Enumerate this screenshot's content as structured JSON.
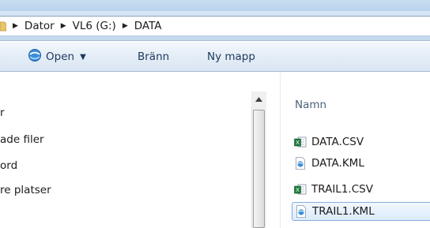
{
  "address": {
    "crumbs": [
      "Dator",
      "VL6 (G:)",
      "DATA"
    ]
  },
  "toolbar": {
    "open_label": "Open",
    "burn_label": "Bränn",
    "new_folder_label": "Ny mapp"
  },
  "nav": {
    "items": [
      "r",
      "ade filer",
      "ord",
      "re platser"
    ]
  },
  "content": {
    "column_header": "Namn",
    "files": [
      {
        "name": "DATA.CSV",
        "icon": "excel-csv-icon"
      },
      {
        "name": "DATA.KML",
        "icon": "kml-file-icon"
      },
      {
        "name": "TRAIL1.CSV",
        "icon": "excel-csv-icon"
      },
      {
        "name": "TRAIL1.KML",
        "icon": "kml-file-icon",
        "selected": true
      }
    ]
  },
  "colors": {
    "accent": "#1e395b",
    "selection_border": "#84acdd"
  }
}
